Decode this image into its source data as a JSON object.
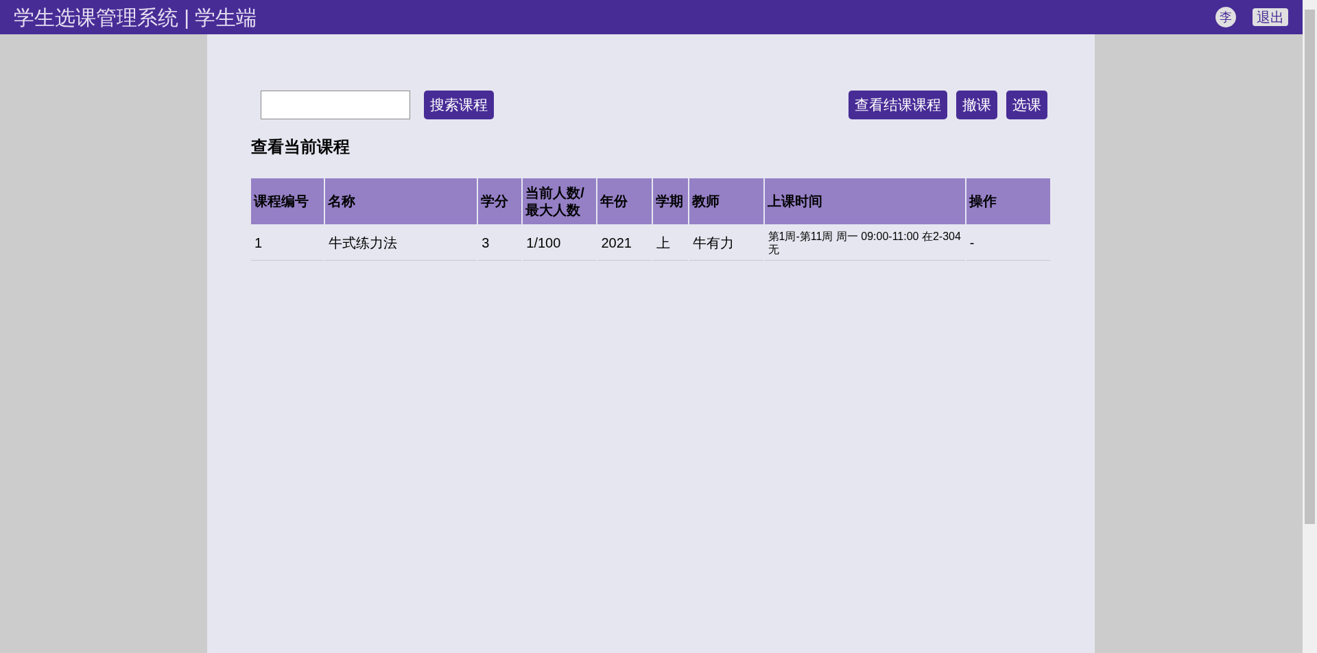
{
  "header": {
    "title": "学生选课管理系统 | 学生端",
    "avatar": "李",
    "logout": "退出"
  },
  "toolbar": {
    "search_button": "搜索课程",
    "buttons": [
      "查看结课课程",
      "撤课",
      "选课"
    ]
  },
  "heading": "查看当前课程",
  "table": {
    "columns": [
      "课程编号",
      "名称",
      "学分",
      "当前人数/最大人数",
      "年份",
      "学期",
      "教师",
      "上课时间",
      "操作"
    ],
    "rows": [
      [
        "1",
        "牛式练力法",
        "3",
        "1/100",
        "2021",
        "上",
        "牛有力",
        "第1周-第11周 周一 09:00-11:00 在2-304 无",
        "-"
      ]
    ]
  }
}
